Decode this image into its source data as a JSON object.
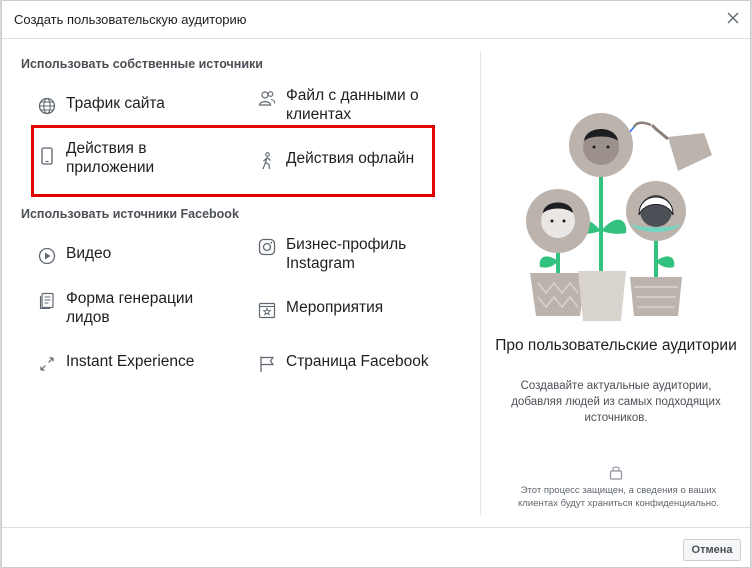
{
  "dialog": {
    "title": "Создать пользовательскую аудиторию",
    "close_icon": "close-icon"
  },
  "own_sources": {
    "heading": "Использовать собственные источники",
    "items": [
      {
        "label": "Трафик сайта",
        "icon": "globe-icon"
      },
      {
        "label": "Файл с данными о клиентах",
        "icon": "people-icon"
      },
      {
        "label": "Действия в приложении",
        "icon": "phone-icon"
      },
      {
        "label": "Действия офлайн",
        "icon": "walking-person-icon"
      }
    ]
  },
  "facebook_sources": {
    "heading": "Использовать источники Facebook",
    "items": [
      {
        "label": "Видео",
        "icon": "play-icon"
      },
      {
        "label": "Бизнес-профиль Instagram",
        "icon": "instagram-icon"
      },
      {
        "label": "Форма генерации лидов",
        "icon": "form-icon"
      },
      {
        "label": "Мероприятия",
        "icon": "event-star-icon"
      },
      {
        "label": "Instant Experience",
        "icon": "expand-arrows-icon"
      },
      {
        "label": "Страница Facebook",
        "icon": "flag-icon"
      }
    ]
  },
  "info": {
    "title": "Про пользовательские аудитории",
    "description": "Создавайте актуальные аудитории, добавляя людей из самых подходящих источников.",
    "note": "Этот процесс защищен, а сведения о ваших клиентах будут храниться конфиденциально.",
    "lock_icon": "lock-icon"
  },
  "footer": {
    "cancel_label": "Отмена"
  },
  "colors": {
    "highlight": "#e00000",
    "text": "#1c1e21",
    "muted": "#4b4f56"
  }
}
